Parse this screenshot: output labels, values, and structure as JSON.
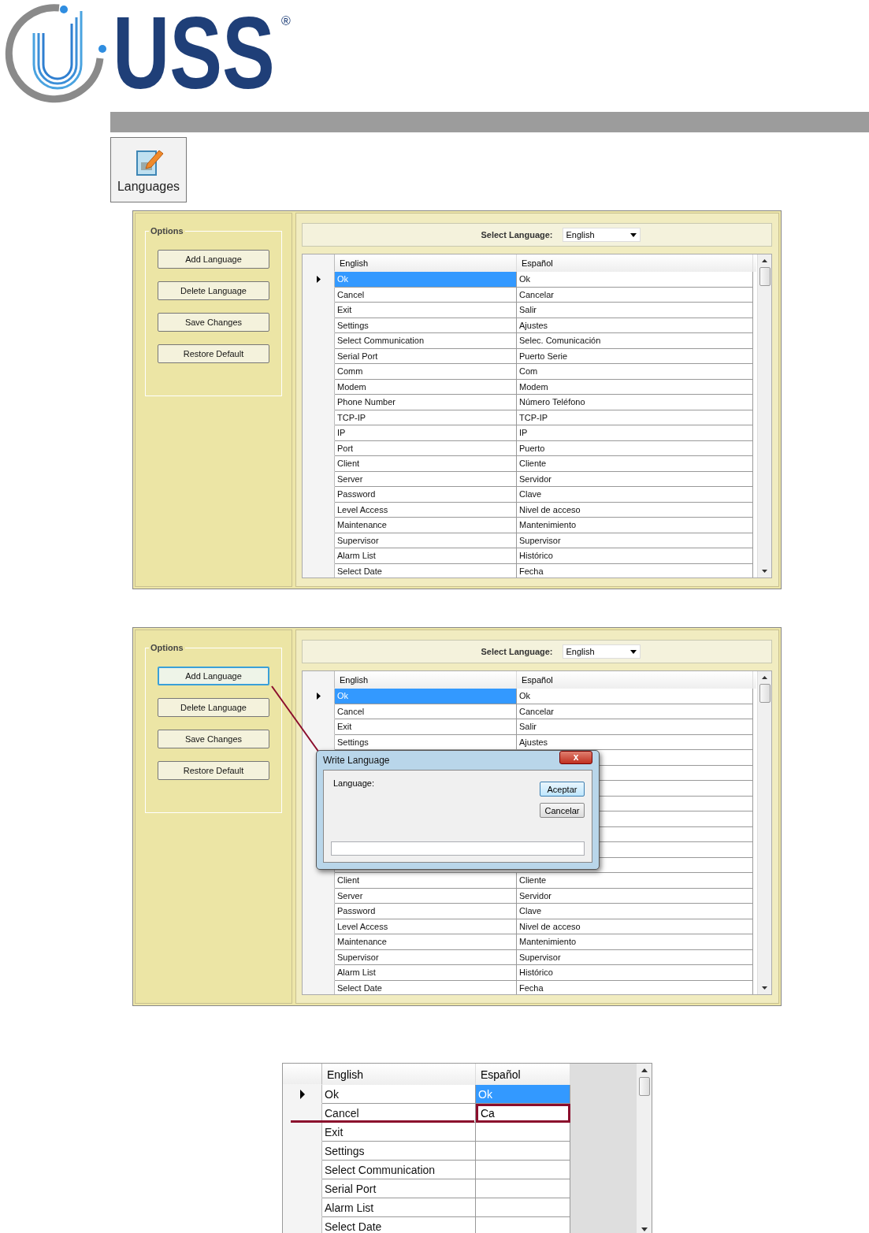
{
  "logo": {
    "wordmark": "USS",
    "registered": "®"
  },
  "languages_button": {
    "label": "Languages"
  },
  "screens": [
    {
      "kind": "editor",
      "options_title": "Options",
      "select_label": "Select Language:",
      "select_value": "English",
      "buttons": [
        {
          "label": "Add Language",
          "focused": false
        },
        {
          "label": "Delete Language",
          "focused": false
        },
        {
          "label": "Save Changes",
          "focused": false
        },
        {
          "label": "Restore Default",
          "focused": false
        }
      ],
      "columns": [
        "English",
        "Español"
      ],
      "rows": [
        {
          "current": true,
          "cells": [
            {
              "text": "Ok",
              "selected": true
            },
            {
              "text": "Ok",
              "selected": false
            }
          ]
        },
        {
          "current": false,
          "cells": [
            {
              "text": "Cancel",
              "selected": false
            },
            {
              "text": "Cancelar",
              "selected": false
            }
          ]
        },
        {
          "current": false,
          "cells": [
            {
              "text": "Exit",
              "selected": false
            },
            {
              "text": "Salir",
              "selected": false
            }
          ]
        },
        {
          "current": false,
          "cells": [
            {
              "text": "Settings",
              "selected": false
            },
            {
              "text": "Ajustes",
              "selected": false
            }
          ]
        },
        {
          "current": false,
          "cells": [
            {
              "text": "Select Communication",
              "selected": false
            },
            {
              "text": "Selec. Comunicación",
              "selected": false
            }
          ]
        },
        {
          "current": false,
          "cells": [
            {
              "text": "Serial Port",
              "selected": false
            },
            {
              "text": "Puerto Serie",
              "selected": false
            }
          ]
        },
        {
          "current": false,
          "cells": [
            {
              "text": "Comm",
              "selected": false
            },
            {
              "text": "Com",
              "selected": false
            }
          ]
        },
        {
          "current": false,
          "cells": [
            {
              "text": "Modem",
              "selected": false
            },
            {
              "text": "Modem",
              "selected": false
            }
          ]
        },
        {
          "current": false,
          "cells": [
            {
              "text": "Phone Number",
              "selected": false
            },
            {
              "text": "Número Teléfono",
              "selected": false
            }
          ]
        },
        {
          "current": false,
          "cells": [
            {
              "text": "TCP-IP",
              "selected": false
            },
            {
              "text": "TCP-IP",
              "selected": false
            }
          ]
        },
        {
          "current": false,
          "cells": [
            {
              "text": "IP",
              "selected": false
            },
            {
              "text": "IP",
              "selected": false
            }
          ]
        },
        {
          "current": false,
          "cells": [
            {
              "text": "Port",
              "selected": false
            },
            {
              "text": "Puerto",
              "selected": false
            }
          ]
        },
        {
          "current": false,
          "cells": [
            {
              "text": "Client",
              "selected": false
            },
            {
              "text": "Cliente",
              "selected": false
            }
          ]
        },
        {
          "current": false,
          "cells": [
            {
              "text": "Server",
              "selected": false
            },
            {
              "text": "Servidor",
              "selected": false
            }
          ]
        },
        {
          "current": false,
          "cells": [
            {
              "text": "Password",
              "selected": false
            },
            {
              "text": "Clave",
              "selected": false
            }
          ]
        },
        {
          "current": false,
          "cells": [
            {
              "text": "Level Access",
              "selected": false
            },
            {
              "text": "Nivel de acceso",
              "selected": false
            }
          ]
        },
        {
          "current": false,
          "cells": [
            {
              "text": "Maintenance",
              "selected": false
            },
            {
              "text": "Mantenimiento",
              "selected": false
            }
          ]
        },
        {
          "current": false,
          "cells": [
            {
              "text": "Supervisor",
              "selected": false
            },
            {
              "text": "Supervisor",
              "selected": false
            }
          ]
        },
        {
          "current": false,
          "cells": [
            {
              "text": "Alarm List",
              "selected": false
            },
            {
              "text": "Histórico",
              "selected": false
            }
          ]
        },
        {
          "current": false,
          "cells": [
            {
              "text": "Select Date",
              "selected": false
            },
            {
              "text": "Fecha",
              "selected": false
            }
          ]
        }
      ]
    },
    {
      "kind": "editor",
      "options_title": "Options",
      "select_label": "Select Language:",
      "select_value": "English",
      "buttons": [
        {
          "label": "Add Language",
          "focused": true
        },
        {
          "label": "Delete Language",
          "focused": false
        },
        {
          "label": "Save Changes",
          "focused": false
        },
        {
          "label": "Restore Default",
          "focused": false
        }
      ],
      "columns": [
        "English",
        "Español"
      ],
      "rows": [
        {
          "current": true,
          "covered": false,
          "cells": [
            {
              "text": "Ok",
              "selected": true
            },
            {
              "text": "Ok",
              "selected": false
            }
          ]
        },
        {
          "current": false,
          "covered": false,
          "cells": [
            {
              "text": "Cancel",
              "selected": false
            },
            {
              "text": "Cancelar",
              "selected": false
            }
          ]
        },
        {
          "current": false,
          "covered": false,
          "cells": [
            {
              "text": "Exit",
              "selected": false
            },
            {
              "text": "Salir",
              "selected": false
            }
          ]
        },
        {
          "current": false,
          "covered": false,
          "cells": [
            {
              "text": "Settings",
              "selected": false
            },
            {
              "text": "Ajustes",
              "selected": false
            }
          ]
        },
        {
          "current": false,
          "covered": true
        },
        {
          "current": false,
          "covered": true
        },
        {
          "current": false,
          "covered": true
        },
        {
          "current": false,
          "covered": true
        },
        {
          "current": false,
          "covered": true
        },
        {
          "current": false,
          "covered": true
        },
        {
          "current": false,
          "covered": true
        },
        {
          "current": false,
          "covered": true
        },
        {
          "current": false,
          "covered": false,
          "cells": [
            {
              "text": "Client",
              "selected": false
            },
            {
              "text": "Cliente",
              "selected": false
            }
          ]
        },
        {
          "current": false,
          "covered": false,
          "cells": [
            {
              "text": "Server",
              "selected": false
            },
            {
              "text": "Servidor",
              "selected": false
            }
          ]
        },
        {
          "current": false,
          "covered": false,
          "cells": [
            {
              "text": "Password",
              "selected": false
            },
            {
              "text": "Clave",
              "selected": false
            }
          ]
        },
        {
          "current": false,
          "covered": false,
          "cells": [
            {
              "text": "Level Access",
              "selected": false
            },
            {
              "text": "Nivel de acceso",
              "selected": false
            }
          ]
        },
        {
          "current": false,
          "covered": false,
          "cells": [
            {
              "text": "Maintenance",
              "selected": false
            },
            {
              "text": "Mantenimiento",
              "selected": false
            }
          ]
        },
        {
          "current": false,
          "covered": false,
          "cells": [
            {
              "text": "Supervisor",
              "selected": false
            },
            {
              "text": "Supervisor",
              "selected": false
            }
          ]
        },
        {
          "current": false,
          "covered": false,
          "cells": [
            {
              "text": "Alarm List",
              "selected": false
            },
            {
              "text": "Histórico",
              "selected": false
            }
          ]
        },
        {
          "current": false,
          "covered": false,
          "cells": [
            {
              "text": "Select Date",
              "selected": false
            },
            {
              "text": "Fecha",
              "selected": false
            }
          ]
        }
      ],
      "dialog": {
        "title": "Write Language",
        "close": "x",
        "label": "Language:",
        "buttons": [
          {
            "label": "Aceptar",
            "default": true
          },
          {
            "label": "Cancelar",
            "default": false
          }
        ]
      }
    },
    {
      "kind": "grid",
      "columns": [
        "English",
        "Español"
      ],
      "rows": [
        {
          "current": true,
          "cells": [
            {
              "text": "Ok",
              "selected": false,
              "editing": false
            },
            {
              "text": "Ok",
              "selected": true,
              "editing": false
            }
          ]
        },
        {
          "current": false,
          "cells": [
            {
              "text": "Cancel",
              "selected": false,
              "editing": false
            },
            {
              "text": "Ca",
              "selected": false,
              "editing": true
            }
          ]
        },
        {
          "current": false,
          "cells": [
            {
              "text": "Exit",
              "selected": false,
              "editing": false
            },
            {
              "selected": false,
              "editing": false
            }
          ]
        },
        {
          "current": false,
          "cells": [
            {
              "text": "Settings",
              "selected": false,
              "editing": false
            },
            {
              "selected": false,
              "editing": false
            }
          ]
        },
        {
          "current": false,
          "cells": [
            {
              "text": "Select Communication",
              "selected": false,
              "editing": false
            },
            {
              "selected": false,
              "editing": false
            }
          ]
        },
        {
          "current": false,
          "cells": [
            {
              "text": "Serial Port",
              "selected": false,
              "editing": false
            },
            {
              "selected": false,
              "editing": false
            }
          ]
        },
        {
          "current": false,
          "cells": [
            {
              "text": "Alarm List",
              "selected": false,
              "editing": false
            },
            {
              "selected": false,
              "editing": false
            }
          ]
        },
        {
          "current": false,
          "cells": [
            {
              "text": "Select Date",
              "selected": false,
              "editing": false
            },
            {
              "selected": false,
              "editing": false
            }
          ]
        }
      ]
    }
  ]
}
